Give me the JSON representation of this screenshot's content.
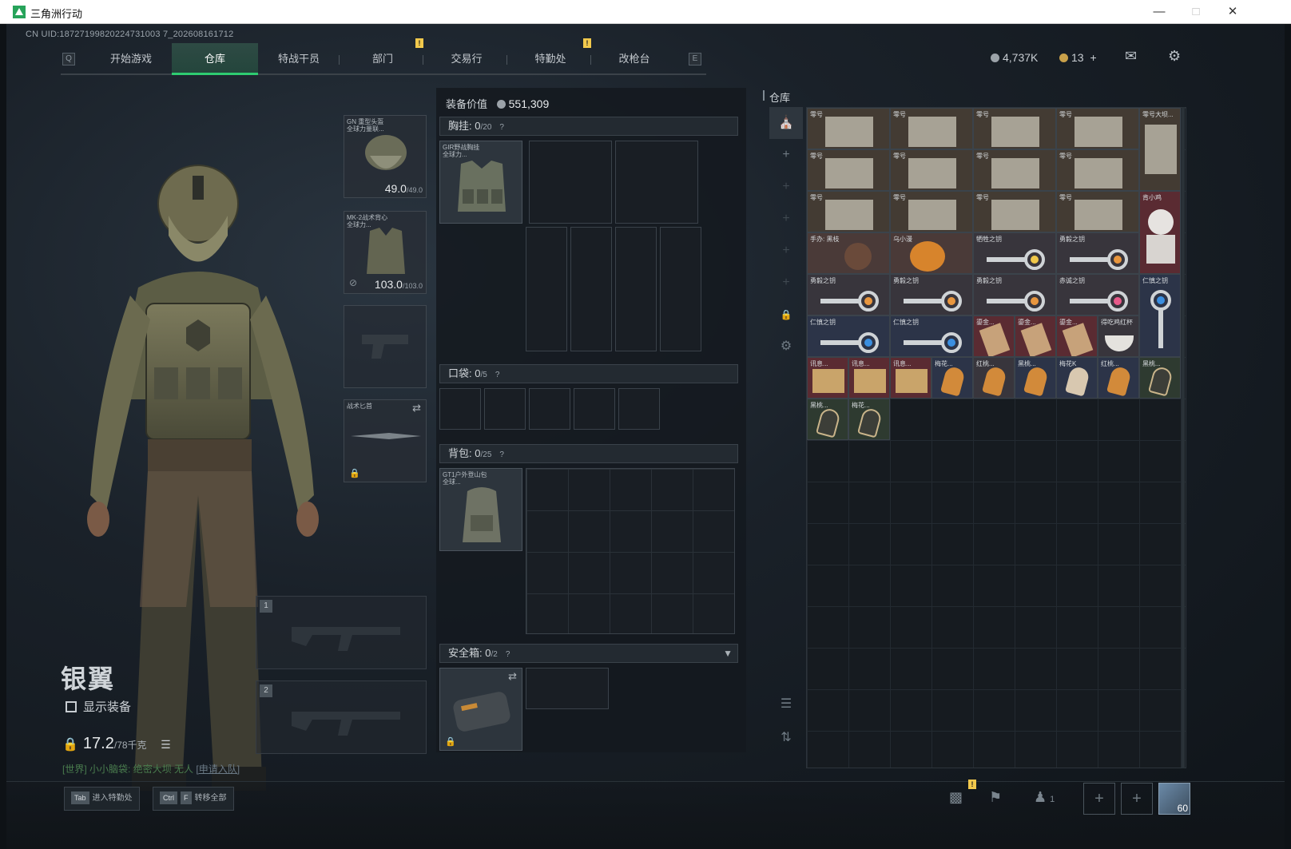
{
  "window": {
    "title": "三角洲行动"
  },
  "uid": "CN UID:18727199820224731003 7_202608161712",
  "nav": {
    "left_key": "Q",
    "right_key": "E",
    "tabs": [
      {
        "label": "开始游戏"
      },
      {
        "label": "仓库"
      },
      {
        "label": "特战干员"
      },
      {
        "label": "部门"
      },
      {
        "label": "交易行"
      },
      {
        "label": "特勤处"
      },
      {
        "label": "改枪台"
      }
    ],
    "alert_glyph": "!"
  },
  "currency": {
    "coins": "4,737K",
    "tickets": "13",
    "plus": "+"
  },
  "character": {
    "name": "银翼",
    "show_equipment": "显示装备",
    "weight": "17.2",
    "weight_max": "/78千克",
    "chat_channel": "[世界]",
    "chat_user": "小小脑袋",
    "chat_msg": ": 绝密大坝 无人",
    "chat_link": "[申请入队]"
  },
  "slots": {
    "helmet": {
      "label": "GN 重型头盔",
      "sub": "全球力量联...",
      "value": "49.0",
      "max": "/49.0"
    },
    "armor": {
      "label": "MK-2战术背心",
      "sub": "全球力...",
      "value": "103.0",
      "max": "/103.0"
    },
    "knife": {
      "label": "战术匕首"
    },
    "weapon1": "1",
    "weapon2": "2"
  },
  "loadout": {
    "equip_value_label": "装备价值",
    "equip_value": "551,309",
    "chest": {
      "label": "胸挂:",
      "count": "0",
      "max": "/20",
      "help": "?",
      "item": "GIR野战胸挂",
      "item_sub": "全球力..."
    },
    "pocket": {
      "label": "口袋:",
      "count": "0",
      "max": "/5",
      "help": "?"
    },
    "backpack": {
      "label": "背包:",
      "count": "0",
      "max": "/25",
      "help": "?",
      "item": "GT1户外登山包",
      "item_sub": "全球..."
    },
    "safe": {
      "label": "安全箱:",
      "count": "0",
      "max": "/2",
      "help": "?"
    }
  },
  "warehouse": {
    "title": "仓库",
    "items": [
      {
        "label": "零号"
      },
      {
        "label": "零号"
      },
      {
        "label": "零号"
      },
      {
        "label": "零号"
      },
      {
        "label": "零号大坝..."
      },
      {
        "label": "零号"
      },
      {
        "label": "零号"
      },
      {
        "label": "零号"
      },
      {
        "label": "零号"
      },
      {
        "label": "零号"
      },
      {
        "label": "零号"
      },
      {
        "label": "零号"
      },
      {
        "label": "零号"
      },
      {
        "label": "手办: 黑枝"
      },
      {
        "label": "乌小漫"
      },
      {
        "label": "牺牲之钥"
      },
      {
        "label": "勇毅之钥"
      },
      {
        "label": "肯小鸡"
      },
      {
        "label": "勇毅之钥"
      },
      {
        "label": "勇毅之钥"
      },
      {
        "label": "勇毅之钥"
      },
      {
        "label": "赤诚之钥"
      },
      {
        "label": "仁慎之钥"
      },
      {
        "label": "仁慎之钥"
      },
      {
        "label": "仁慎之钥"
      },
      {
        "label": "鎏金..."
      },
      {
        "label": "鎏金..."
      },
      {
        "label": "鎏金..."
      },
      {
        "label": "得吃鸡红杯"
      },
      {
        "label": "讯息..."
      },
      {
        "label": "讯息..."
      },
      {
        "label": "讯息..."
      },
      {
        "label": "梅花..."
      },
      {
        "label": "红桃..."
      },
      {
        "label": "黑桃..."
      },
      {
        "label": "梅花K"
      },
      {
        "label": "红桃..."
      },
      {
        "label": "黑桃..."
      },
      {
        "label": "黑桃..."
      },
      {
        "label": "梅花..."
      }
    ]
  },
  "bottom": {
    "tab_key": "Tab",
    "tab_label": "进入特勤处",
    "ctrl_key": "Ctrl",
    "f_key": "F",
    "ctrl_label": "转移全部",
    "squad_count": "1",
    "level": "60",
    "plus": "+"
  },
  "colors": {
    "accent": "#2ecc71",
    "alert": "#f2c94c",
    "bg": "#0e1216"
  }
}
